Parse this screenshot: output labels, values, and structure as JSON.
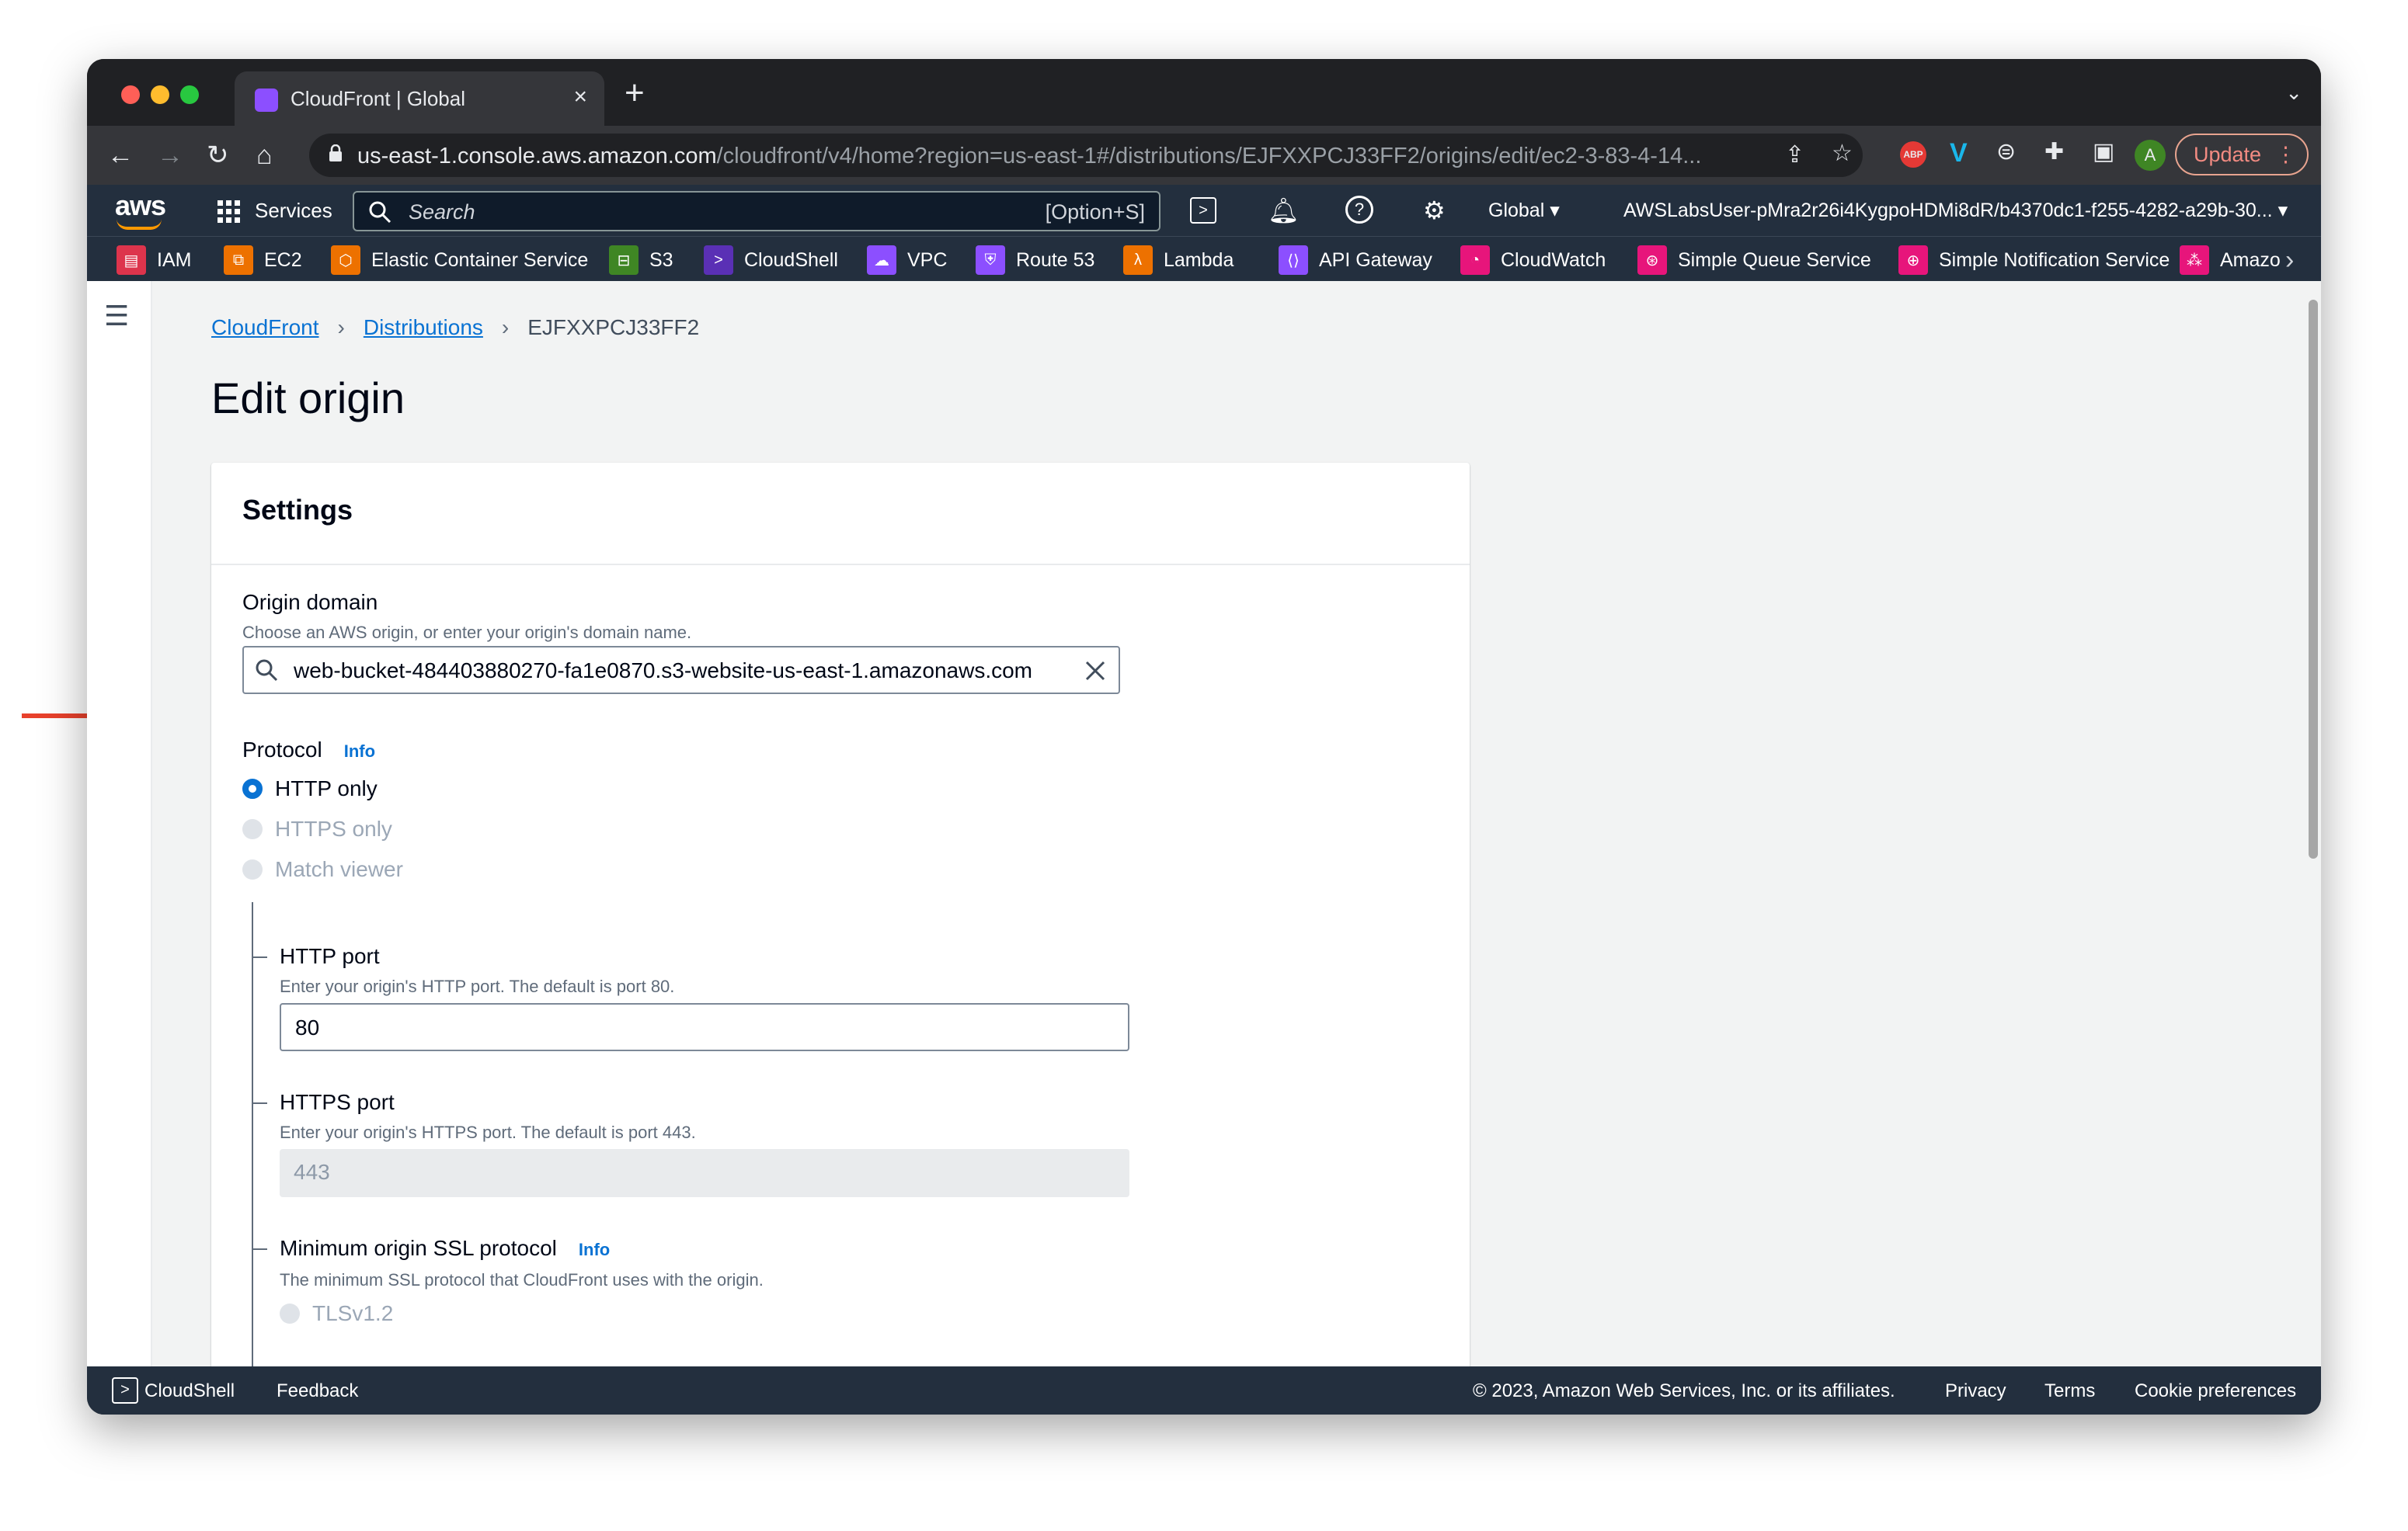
{
  "browser": {
    "tab_title": "CloudFront | Global",
    "url_host": "us-east-1.console.aws.amazon.com",
    "url_path": "/cloudfront/v4/home?region=us-east-1#/distributions/EJFXXPCJ33FF2/origins/edit/ec2-3-83-4-14...",
    "update_label": "Update",
    "avatar_letter": "A",
    "abp_label": "ABP"
  },
  "aws_header": {
    "logo": "aws",
    "services_label": "Services",
    "search_placeholder": "Search",
    "search_shortcut": "[Option+S]",
    "region_label": "Global",
    "account_label": "AWSLabsUser-pMra2r26i4KygpoHDMi8dR/b4370dc1-f255-4282-a29b-30..."
  },
  "favorites": [
    {
      "label": "IAM",
      "color": "#dd344c"
    },
    {
      "label": "EC2",
      "color": "#ed7100"
    },
    {
      "label": "Elastic Container Service",
      "color": "#ed7100"
    },
    {
      "label": "S3",
      "color": "#3f8624"
    },
    {
      "label": "CloudShell",
      "color": "#5a30b5"
    },
    {
      "label": "VPC",
      "color": "#8c4fff"
    },
    {
      "label": "Route 53",
      "color": "#8c4fff"
    },
    {
      "label": "Lambda",
      "color": "#ed7100"
    },
    {
      "label": "API Gateway",
      "color": "#8c4fff"
    },
    {
      "label": "CloudWatch",
      "color": "#e7157b"
    },
    {
      "label": "Simple Queue Service",
      "color": "#e7157b"
    },
    {
      "label": "Simple Notification Service",
      "color": "#e7157b"
    },
    {
      "label": "Amazo",
      "color": "#e7157b"
    }
  ],
  "breadcrumb": {
    "items": [
      "CloudFront",
      "Distributions",
      "EJFXXPCJ33FF2"
    ]
  },
  "page": {
    "title": "Edit origin"
  },
  "settings": {
    "title": "Settings",
    "origin_domain": {
      "label": "Origin domain",
      "description": "Choose an AWS origin, or enter your origin's domain name.",
      "value": "web-bucket-484403880270-fa1e0870.s3-website-us-east-1.amazonaws.com"
    },
    "protocol": {
      "label": "Protocol",
      "info": "Info",
      "options": [
        "HTTP only",
        "HTTPS only",
        "Match viewer"
      ],
      "selected": "HTTP only"
    },
    "http_port": {
      "label": "HTTP port",
      "description": "Enter your origin's HTTP port. The default is port 80.",
      "value": "80"
    },
    "https_port": {
      "label": "HTTPS port",
      "description": "Enter your origin's HTTPS port. The default is port 443.",
      "value": "443"
    },
    "min_ssl": {
      "label": "Minimum origin SSL protocol",
      "info": "Info",
      "description": "The minimum SSL protocol that CloudFront uses with the origin.",
      "option_1": "TLSv1.2"
    }
  },
  "footer": {
    "cloudshell": "CloudShell",
    "feedback": "Feedback",
    "copyright": "© 2023, Amazon Web Services, Inc. or its affiliates.",
    "privacy": "Privacy",
    "terms": "Terms",
    "cookies": "Cookie preferences"
  },
  "colors": {
    "annotation_arrow": "#e8412c",
    "link": "#0972d3",
    "aws_nav": "#232f3e"
  }
}
